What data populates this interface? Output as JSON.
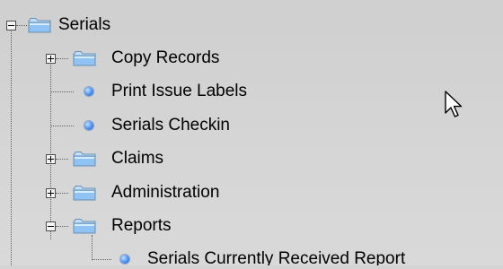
{
  "tree": {
    "root": {
      "label": "Serials",
      "icon": "folder-icon",
      "expanded": true
    },
    "items": [
      {
        "label": "Copy Records",
        "type": "folder",
        "icon": "folder-icon",
        "expanded": false
      },
      {
        "label": "Print Issue Labels",
        "type": "leaf",
        "icon": "bullet-icon"
      },
      {
        "label": "Serials Checkin",
        "type": "leaf",
        "icon": "bullet-icon"
      },
      {
        "label": "Claims",
        "type": "folder",
        "icon": "folder-icon",
        "expanded": false
      },
      {
        "label": "Administration",
        "type": "folder",
        "icon": "folder-icon",
        "expanded": false
      },
      {
        "label": "Reports",
        "type": "folder",
        "icon": "folder-icon",
        "expanded": true
      },
      {
        "label": "Serials Currently Received Report",
        "type": "leaf",
        "icon": "bullet-icon"
      }
    ]
  },
  "colors": {
    "background": "#d4d4d4",
    "folder_blue": "#8ec3f3",
    "bullet_blue": "#4a8ff2",
    "text": "#000000"
  }
}
